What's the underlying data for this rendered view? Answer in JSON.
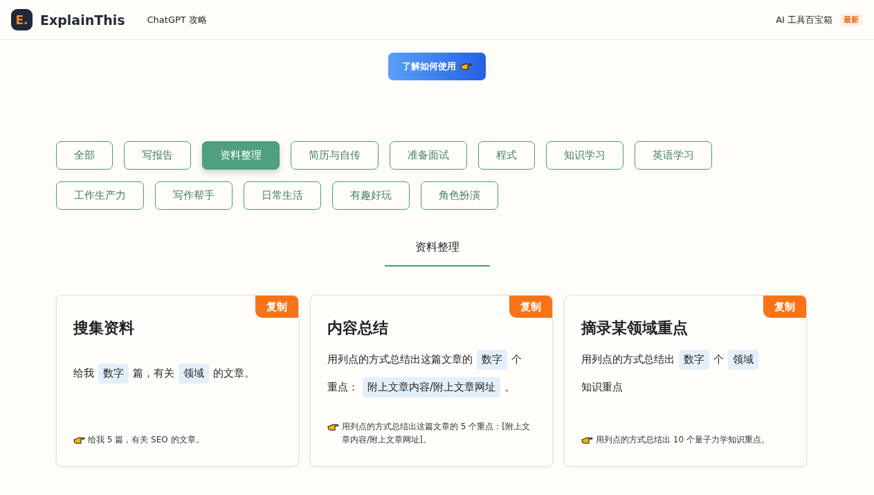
{
  "header": {
    "logo_letter": "E.",
    "brand": "ExplainThis",
    "nav": [
      {
        "label": "ChatGPT 攻略"
      }
    ],
    "right_link": "AI 工具百宝箱",
    "right_badge": "最新"
  },
  "cta": {
    "label": "了解如何使用"
  },
  "filters": [
    {
      "label": "全部",
      "selected": false
    },
    {
      "label": "写报告",
      "selected": false
    },
    {
      "label": "资料整理",
      "selected": true
    },
    {
      "label": "简历与自传",
      "selected": false
    },
    {
      "label": "准备面试",
      "selected": false
    },
    {
      "label": "程式",
      "selected": false
    },
    {
      "label": "知识学习",
      "selected": false
    },
    {
      "label": "英语学习",
      "selected": false
    },
    {
      "label": "工作生产力",
      "selected": false
    },
    {
      "label": "写作帮手",
      "selected": false
    },
    {
      "label": "日常生活",
      "selected": false
    },
    {
      "label": "有趣好玩",
      "selected": false
    },
    {
      "label": "角色扮演",
      "selected": false
    }
  ],
  "section_title": "资料整理",
  "cards": [
    {
      "title": "搜集资料",
      "copy_label": "复制",
      "prompt": [
        {
          "kind": "text",
          "text": "给我"
        },
        {
          "kind": "chip",
          "text": "数字"
        },
        {
          "kind": "text",
          "text": "篇，有关"
        },
        {
          "kind": "chip",
          "text": "领域"
        },
        {
          "kind": "text",
          "text": "的文章。"
        }
      ],
      "example": "给我 5 篇，有关 SEO 的文章。"
    },
    {
      "title": "内容总结",
      "copy_label": "复制",
      "prompt": [
        {
          "kind": "text",
          "text": "用列点的方式总结出这篇文章的"
        },
        {
          "kind": "chip",
          "text": "数字"
        },
        {
          "kind": "text",
          "text": "个"
        },
        {
          "kind": "text",
          "text": "重点："
        },
        {
          "kind": "chip",
          "text": "附上文章内容/附上文章网址"
        },
        {
          "kind": "text",
          "text": "。"
        }
      ],
      "example": "用列点的方式总结出这篇文章的 5 个重点：[附上文章内容/附上文章网址]。"
    },
    {
      "title": "摘录某领域重点",
      "copy_label": "复制",
      "prompt": [
        {
          "kind": "text",
          "text": "用列点的方式总结出"
        },
        {
          "kind": "chip",
          "text": "数字"
        },
        {
          "kind": "text",
          "text": "个"
        },
        {
          "kind": "chip",
          "text": "领域"
        },
        {
          "kind": "text",
          "text": "知识重点"
        }
      ],
      "example": "用列点的方式总结出 10 个量子力学知识重点。"
    }
  ]
}
